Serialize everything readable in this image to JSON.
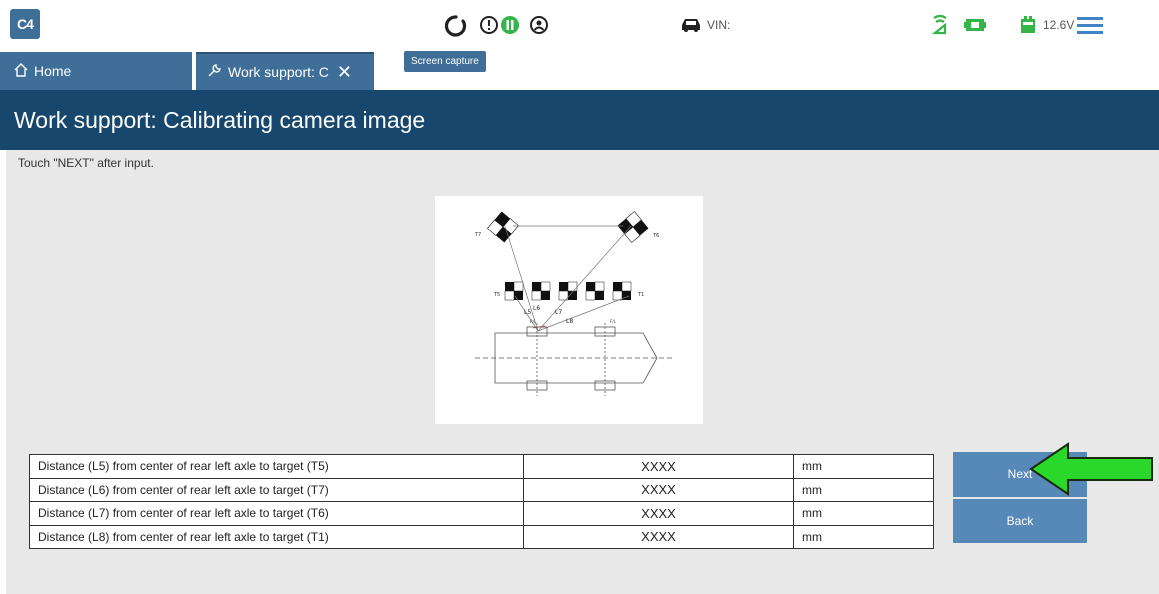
{
  "app": {
    "logo_text": "C4",
    "tooltip": "Screen capture",
    "vin_label": "VIN:",
    "battery_voltage": "12.6V",
    "icons": [
      "refresh-icon",
      "alert-icon",
      "pause-icon",
      "user-icon",
      "car-icon",
      "signal-icon",
      "vci-icon",
      "battery-icon",
      "menu-icon"
    ]
  },
  "tabs": {
    "home_label": "Home",
    "work_label": "Work support: C"
  },
  "page": {
    "title": "Work support: Calibrating camera image",
    "instruction": "Touch \"NEXT\" after input."
  },
  "diagram": {
    "labels": {
      "t7": "T7",
      "t6": "T6",
      "t5": "T5",
      "t1": "T1",
      "l5": "L5",
      "l6": "L6",
      "l7": "L7",
      "l8": "L8",
      "rl": "R/L",
      "fl": "F/L",
      "rr": "R/L"
    }
  },
  "table": {
    "rows": [
      {
        "label": "Distance (L5) from center of rear left axle to target (T5)",
        "value": "XXXX",
        "unit": "mm"
      },
      {
        "label": "Distance (L6) from center of rear left axle to target (T7)",
        "value": "XXXX",
        "unit": "mm"
      },
      {
        "label": "Distance (L7) from center of rear left axle to target (T6)",
        "value": "XXXX",
        "unit": "mm"
      },
      {
        "label": "Distance (L8) from center of rear left axle to target (T1)",
        "value": "XXXX",
        "unit": "mm"
      }
    ]
  },
  "buttons": {
    "next_label": "Next",
    "back_label": "Back"
  },
  "colors": {
    "primary": "#3f6f98",
    "title_bar": "#17476c",
    "button": "#5689b8",
    "accent_green": "#35b44a",
    "arrow_green": "#29d82b"
  }
}
